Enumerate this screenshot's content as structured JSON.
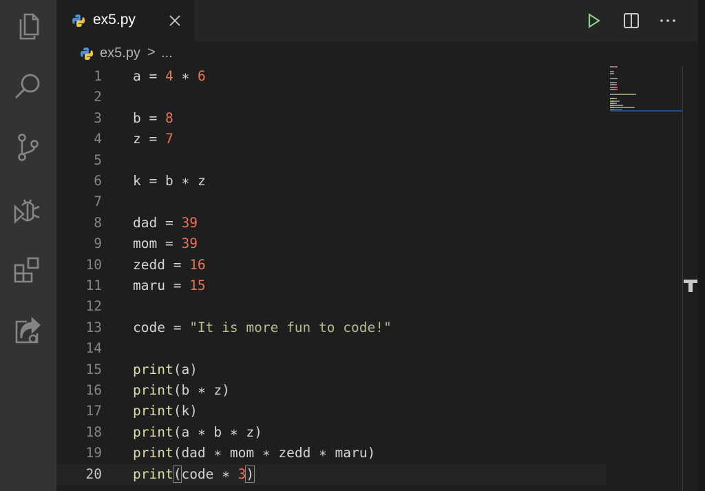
{
  "activity_bar": {
    "icons": [
      "explorer-icon",
      "search-icon",
      "source-control-icon",
      "run-debug-icon",
      "extensions-icon",
      "live-share-icon"
    ]
  },
  "tab": {
    "label": "ex5.py",
    "icon": "python-icon"
  },
  "toolbar": {
    "actions": [
      "run-icon",
      "split-editor-icon",
      "more-actions-icon"
    ]
  },
  "breadcrumb": {
    "file": "ex5.py",
    "separator": ">",
    "more": "..."
  },
  "editor": {
    "current_line": 20,
    "lines": [
      {
        "n": "1",
        "tokens": [
          [
            "v",
            "a "
          ],
          [
            "o",
            "= "
          ],
          [
            "n",
            "4 "
          ],
          [
            "o",
            "∗ "
          ],
          [
            "n",
            "6"
          ]
        ]
      },
      {
        "n": "2",
        "tokens": []
      },
      {
        "n": "3",
        "tokens": [
          [
            "v",
            "b "
          ],
          [
            "o",
            "= "
          ],
          [
            "n",
            "8"
          ]
        ]
      },
      {
        "n": "4",
        "tokens": [
          [
            "v",
            "z "
          ],
          [
            "o",
            "= "
          ],
          [
            "n",
            "7"
          ]
        ]
      },
      {
        "n": "5",
        "tokens": []
      },
      {
        "n": "6",
        "tokens": [
          [
            "v",
            "k "
          ],
          [
            "o",
            "= "
          ],
          [
            "v",
            "b "
          ],
          [
            "o",
            "∗ "
          ],
          [
            "v",
            "z"
          ]
        ]
      },
      {
        "n": "7",
        "tokens": []
      },
      {
        "n": "8",
        "tokens": [
          [
            "v",
            "dad "
          ],
          [
            "o",
            "= "
          ],
          [
            "n",
            "39"
          ]
        ]
      },
      {
        "n": "9",
        "tokens": [
          [
            "v",
            "mom "
          ],
          [
            "o",
            "= "
          ],
          [
            "n",
            "39"
          ]
        ]
      },
      {
        "n": "10",
        "tokens": [
          [
            "v",
            "zedd "
          ],
          [
            "o",
            "= "
          ],
          [
            "n",
            "16"
          ]
        ]
      },
      {
        "n": "11",
        "tokens": [
          [
            "v",
            "maru "
          ],
          [
            "o",
            "= "
          ],
          [
            "n",
            "15"
          ]
        ]
      },
      {
        "n": "12",
        "tokens": []
      },
      {
        "n": "13",
        "tokens": [
          [
            "v",
            "code "
          ],
          [
            "o",
            "= "
          ],
          [
            "s",
            "\"It is more fun to code!\""
          ]
        ]
      },
      {
        "n": "14",
        "tokens": []
      },
      {
        "n": "15",
        "tokens": [
          [
            "f",
            "print"
          ],
          [
            "v",
            "(a)"
          ]
        ]
      },
      {
        "n": "16",
        "tokens": [
          [
            "f",
            "print"
          ],
          [
            "v",
            "(b "
          ],
          [
            "o",
            "∗ "
          ],
          [
            "v",
            "z)"
          ]
        ]
      },
      {
        "n": "17",
        "tokens": [
          [
            "f",
            "print"
          ],
          [
            "v",
            "(k)"
          ]
        ]
      },
      {
        "n": "18",
        "tokens": [
          [
            "f",
            "print"
          ],
          [
            "v",
            "(a "
          ],
          [
            "o",
            "∗ "
          ],
          [
            "v",
            "b "
          ],
          [
            "o",
            "∗ "
          ],
          [
            "v",
            "z)"
          ]
        ]
      },
      {
        "n": "19",
        "tokens": [
          [
            "f",
            "print"
          ],
          [
            "v",
            "(dad "
          ],
          [
            "o",
            "∗ "
          ],
          [
            "v",
            "mom "
          ],
          [
            "o",
            "∗ "
          ],
          [
            "v",
            "zedd "
          ],
          [
            "o",
            "∗ "
          ],
          [
            "v",
            "maru)"
          ]
        ]
      },
      {
        "n": "20",
        "tokens": [
          [
            "f",
            "print"
          ],
          [
            "b",
            "("
          ],
          [
            "v",
            "code "
          ],
          [
            "o",
            "∗ "
          ],
          [
            "n",
            "3"
          ],
          [
            "b",
            ")"
          ]
        ]
      }
    ]
  },
  "colors": {
    "background": "#1e1e1e",
    "activity_bar": "#333333",
    "number": "#e8735b",
    "string": "#b5bd8c",
    "function": "#dcdcaa",
    "run_green": "#89d185"
  }
}
